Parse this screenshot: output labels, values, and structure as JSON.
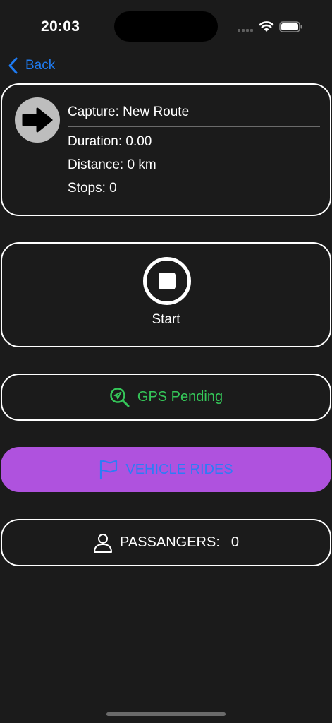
{
  "status_bar": {
    "time": "20:03"
  },
  "nav": {
    "back_label": "Back"
  },
  "route": {
    "title": "Capture: New Route",
    "duration": "Duration: 0.00",
    "distance": "Distance: 0 km",
    "stops": "Stops: 0"
  },
  "start": {
    "label": "Start"
  },
  "gps": {
    "label": "GPS Pending"
  },
  "vehicle_rides": {
    "label": "VEHICLE RIDES"
  },
  "passengers": {
    "label": "PASSANGERS:",
    "count": "0"
  },
  "icons": {
    "back": "chevron-left-icon",
    "route": "arrow-right-icon",
    "start": "stop-circle-icon",
    "gps": "location-search-icon",
    "rides": "flag-icon",
    "passengers": "person-icon"
  },
  "colors": {
    "background": "#1b1b1b",
    "link_blue": "#1e7bf2",
    "gps_green": "#35c759",
    "rides_purple": "#af52de",
    "rides_text": "#2d7cf6"
  }
}
